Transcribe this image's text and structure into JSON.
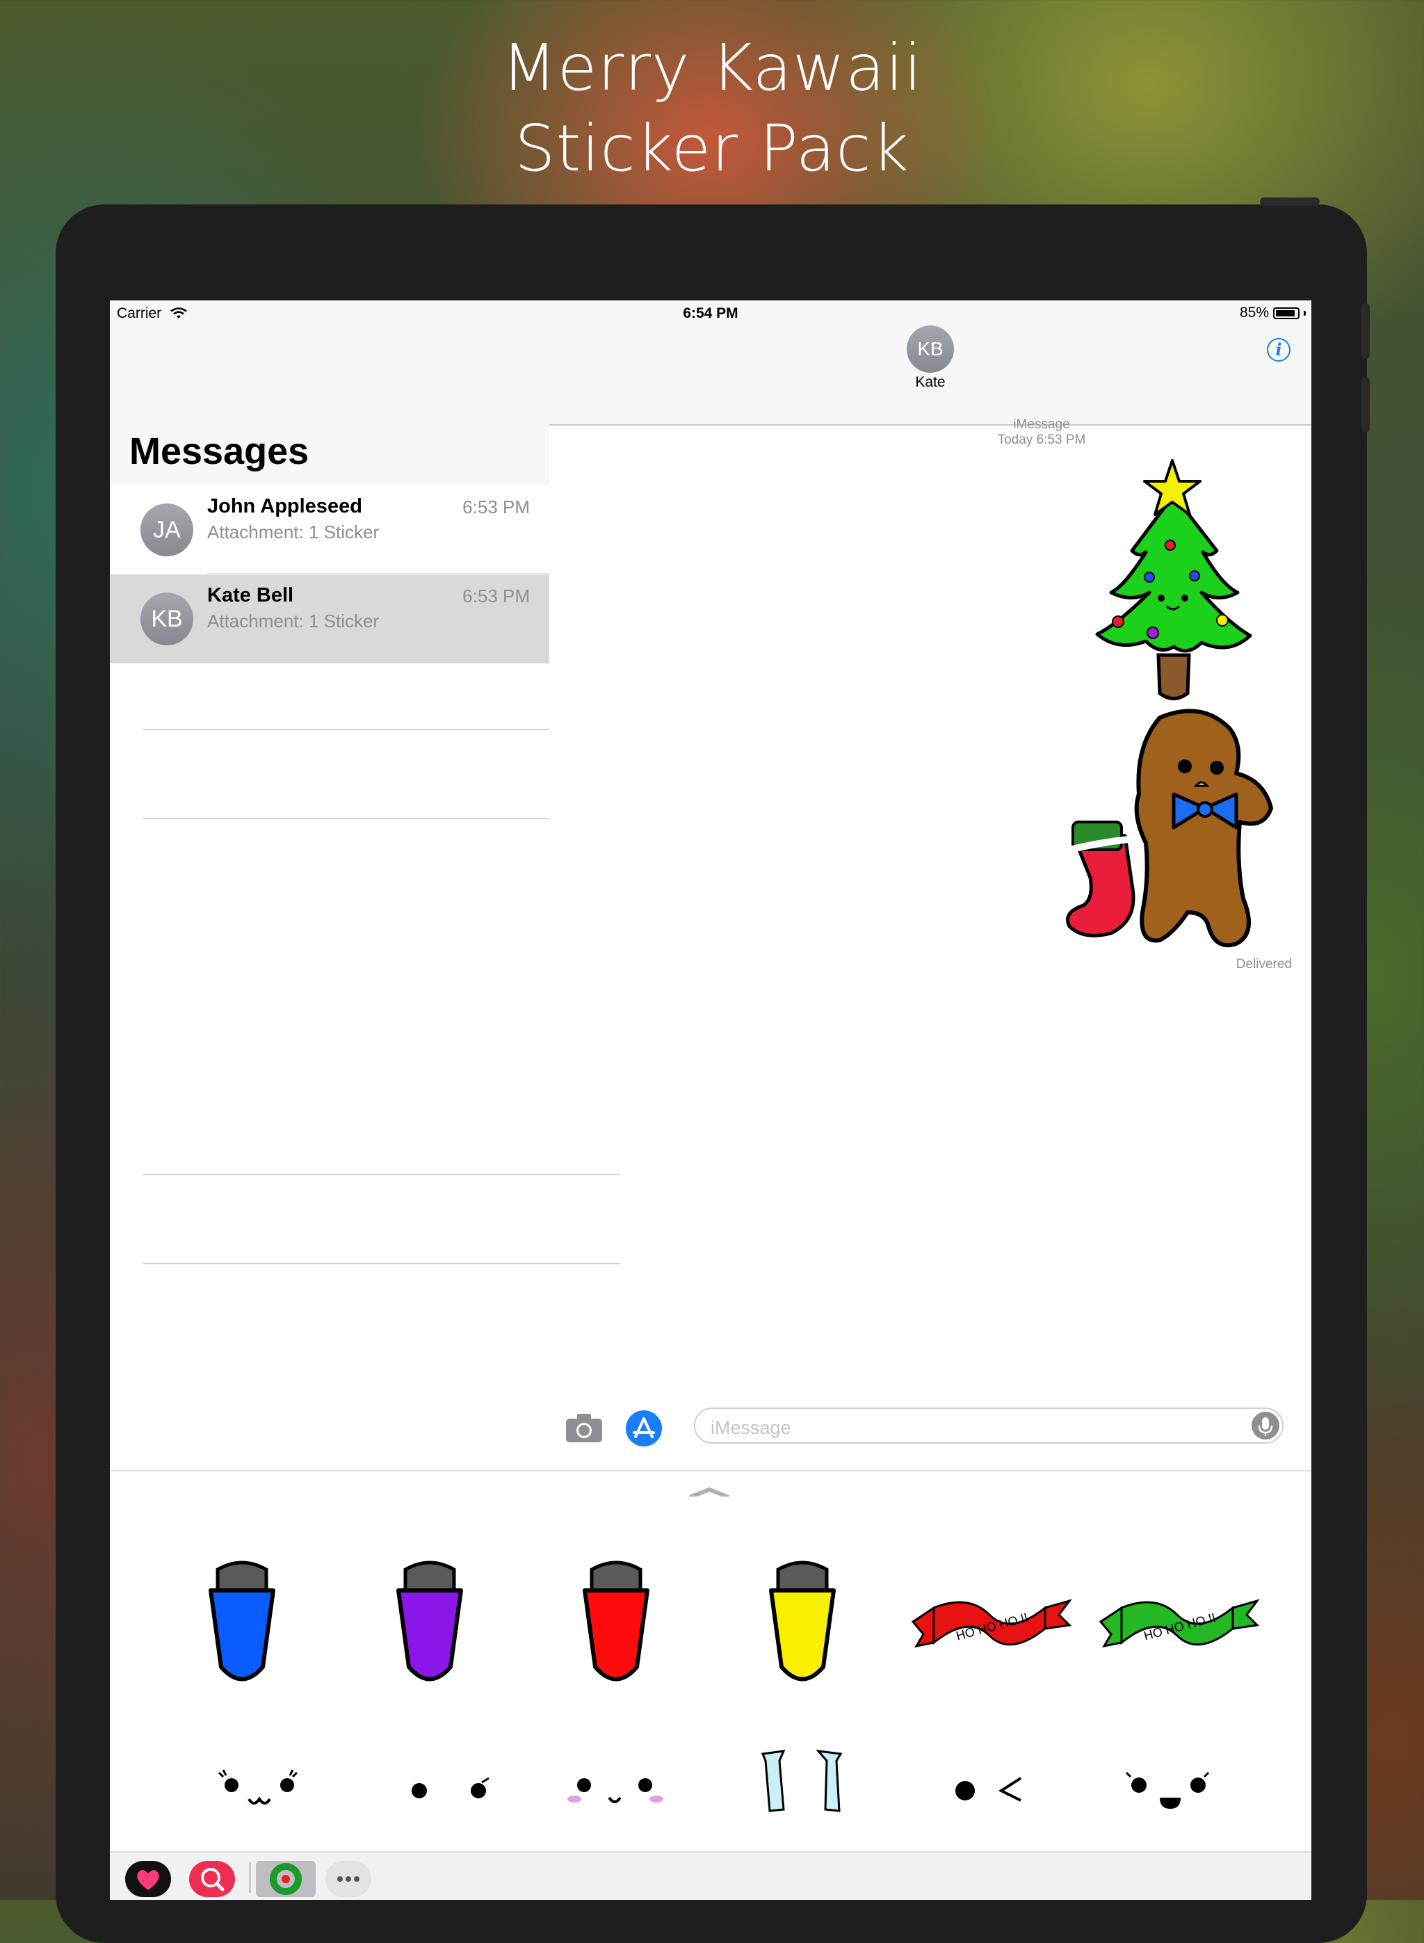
{
  "promo": {
    "title_line1": "Merry Kawaii",
    "title_line2": "Sticker Pack"
  },
  "status_bar": {
    "carrier": "Carrier",
    "time": "6:54 PM",
    "battery": "85%",
    "battery_level": 0.85
  },
  "sidebar": {
    "title": "Messages",
    "conversations": [
      {
        "initials": "JA",
        "name": "John Appleseed",
        "time": "6:53 PM",
        "preview": "Attachment: 1 Sticker",
        "selected": false
      },
      {
        "initials": "KB",
        "name": "Kate Bell",
        "time": "6:53 PM",
        "preview": "Attachment: 1 Sticker",
        "selected": true
      }
    ]
  },
  "conversation": {
    "contact_initials": "KB",
    "contact_name": "Kate",
    "service": "iMessage",
    "timestamp": "Today 6:53 PM",
    "status": "Delivered",
    "stickers": [
      "christmas-tree",
      "gingerbread-with-stocking"
    ]
  },
  "compose": {
    "placeholder": "iMessage"
  },
  "tray": {
    "row1": [
      "blue-bulb",
      "purple-bulb",
      "red-bulb",
      "yellow-bulb",
      "red-ribbon",
      "green-ribbon"
    ],
    "row2": [
      "kawaii-face-1",
      "kawaii-face-2",
      "kawaii-face-3",
      "kawaii-face-4",
      "kawaii-face-5",
      "kawaii-face-6"
    ],
    "ribbon_text": "HO HO HO !!",
    "colors": {
      "blue": "#0a5cff",
      "purple": "#8a16ea",
      "red": "#ff0b0b",
      "yellow": "#f8f000",
      "red_ribbon": "#e81212",
      "green_ribbon": "#23b824"
    }
  },
  "app_drawer": {
    "apps": [
      "love-app-icon",
      "search-app-icon",
      "wreath-app-icon",
      "more-icon"
    ]
  }
}
